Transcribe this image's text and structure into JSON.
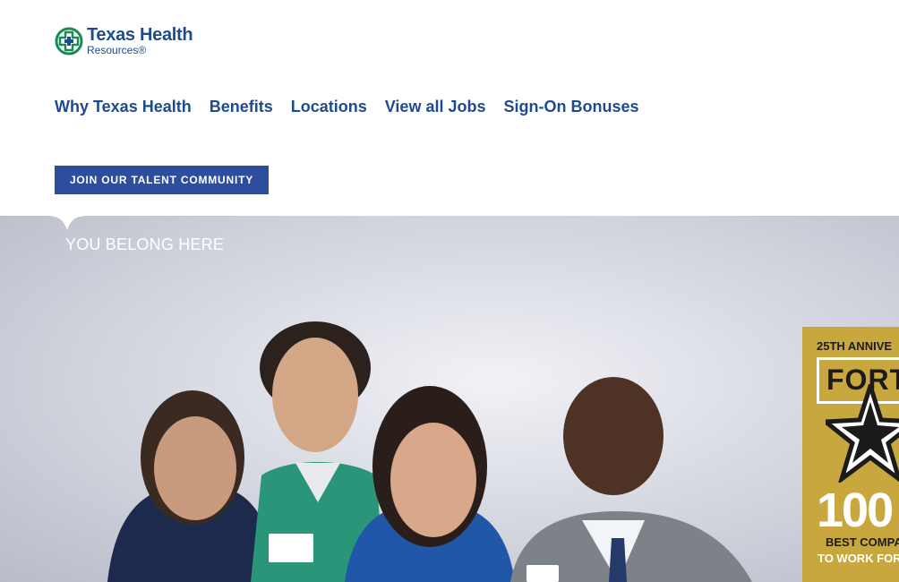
{
  "logo": {
    "line1": "Texas Health",
    "line2": "Resources®",
    "colors": {
      "green": "#1a8a57",
      "blue": "#1f4b8e"
    }
  },
  "nav": {
    "items": [
      {
        "label": "Why Texas Health"
      },
      {
        "label": "Benefits"
      },
      {
        "label": "Locations"
      },
      {
        "label": "View all Jobs"
      },
      {
        "label": "Sign-On Bonuses"
      }
    ]
  },
  "cta": {
    "label": "JOIN OUR TALENT COMMUNITY",
    "color": "#2c4e9c"
  },
  "hero": {
    "tagline": "YOU BELONG HERE",
    "badge": {
      "top_line": "25TH ANNIVE",
      "word": "FORTU",
      "number": "100",
      "bottom_line1": "BEST COMPA",
      "bottom_line2": "TO WORK FOR",
      "color": "#c9a73f"
    }
  }
}
